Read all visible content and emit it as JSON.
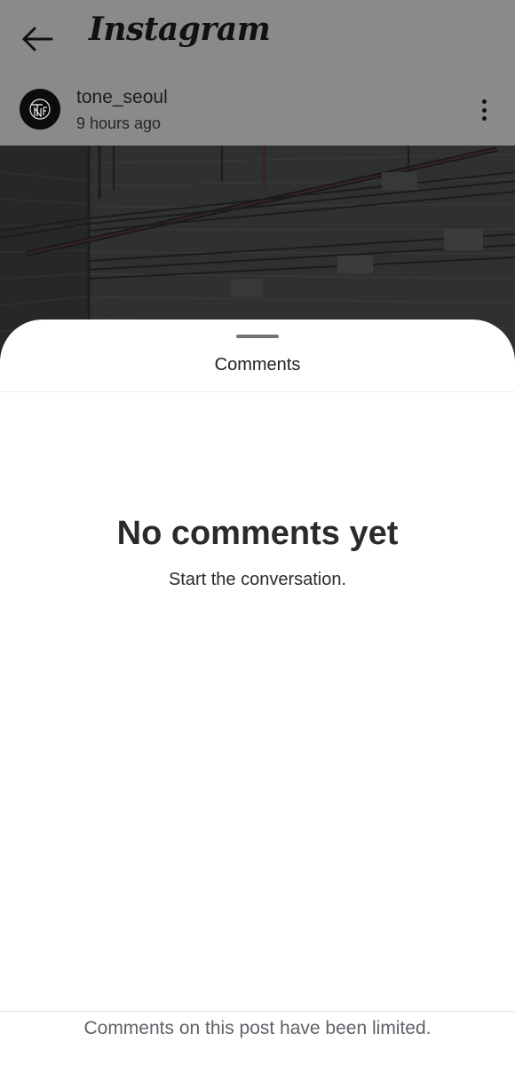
{
  "header": {
    "back_icon": "arrow-left-icon",
    "app_title": "Instagram"
  },
  "post": {
    "username": "tone_seoul",
    "time_ago": "9 hours ago",
    "more_icon": "more-vertical-icon"
  },
  "comments_sheet": {
    "title": "Comments",
    "empty_title": "No comments yet",
    "empty_subtitle": "Start the conversation.",
    "footer_note": "Comments on this post have been limited."
  },
  "colors": {
    "scrim": "#8a8a8a",
    "sheet_background": "#ffffff",
    "primary_text": "#2b2b2e",
    "secondary_text": "#5f6368"
  }
}
